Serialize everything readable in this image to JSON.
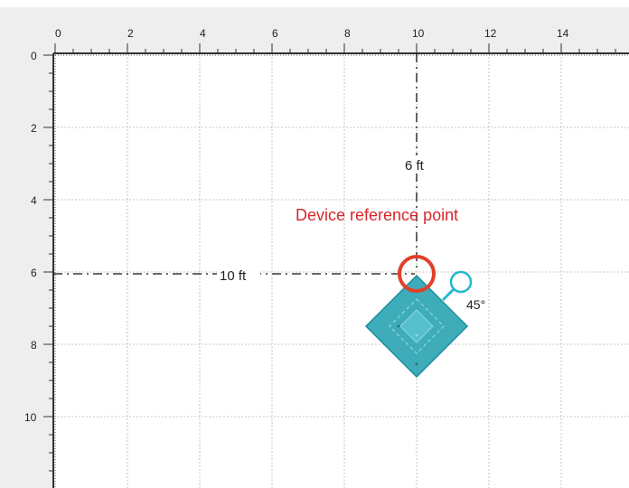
{
  "floor_plan": {
    "ruler_x_ticks": [
      "0",
      "2",
      "4",
      "6",
      "8",
      "10",
      "12",
      "14"
    ],
    "ruler_y_ticks": [
      "0",
      "2",
      "4",
      "6",
      "8",
      "10"
    ],
    "device_reference_label": "Device reference point",
    "horizontal_distance_label": "10 ft",
    "vertical_distance_label": "6 ft",
    "rotation_label": "45°",
    "device_position_ft": {
      "x": 10,
      "y": 6
    },
    "device_rotation_deg": 45,
    "colors": {
      "device_fill": "#2aa3b3",
      "device_outline": "#1b8f9c",
      "reference_circle": "#e0402a",
      "rotation_handle": "#23b8cf",
      "reference_text": "#d7262b",
      "grid": "#b5b5b5",
      "ruler_background": "#eeeeee"
    }
  }
}
